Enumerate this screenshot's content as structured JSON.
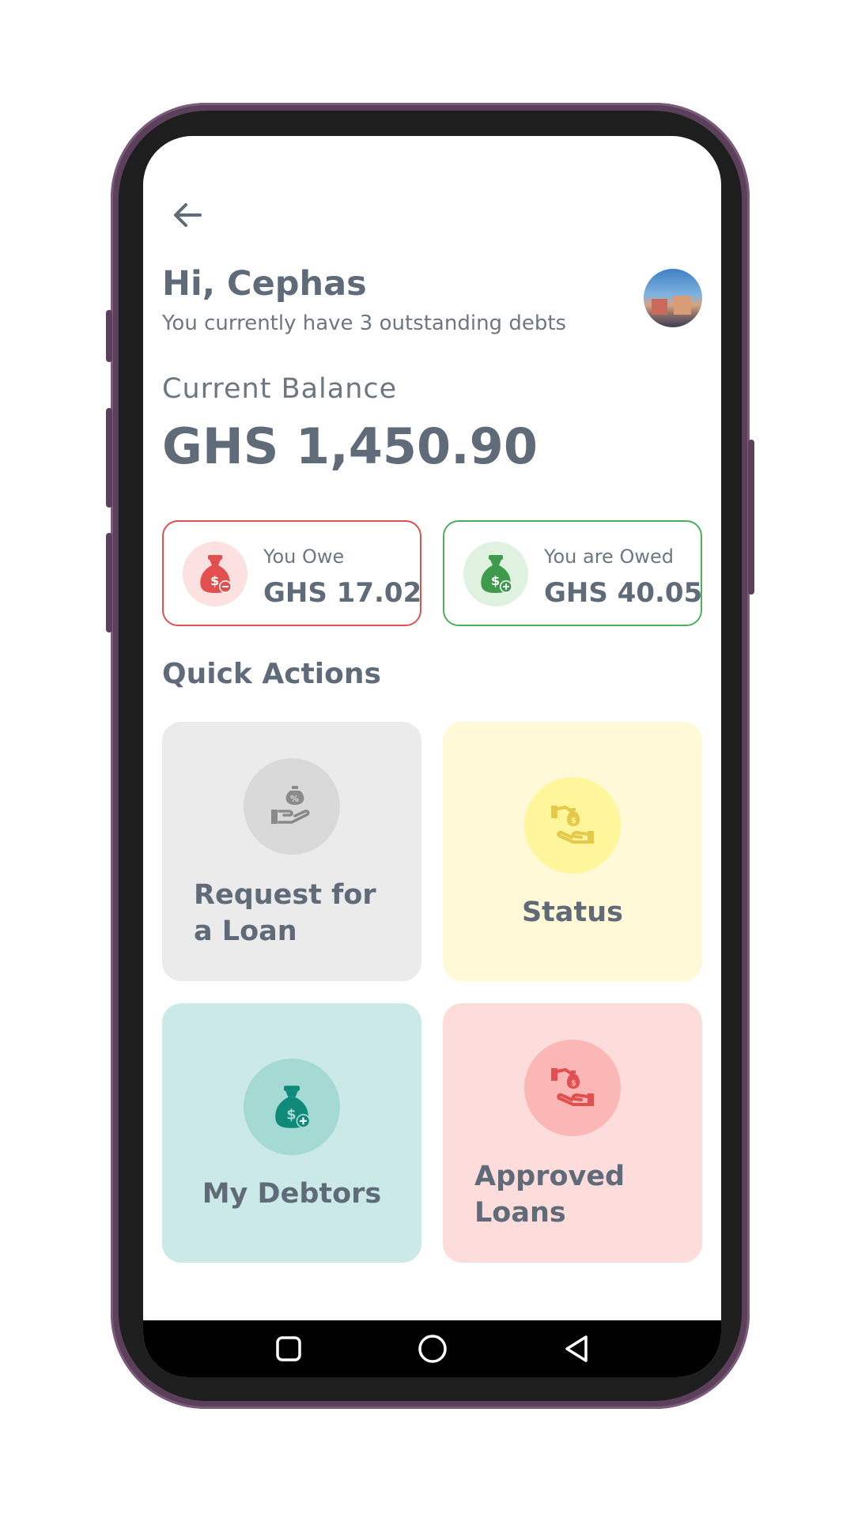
{
  "header": {
    "greeting": "Hi, Cephas",
    "subtitle": "You currently have 3 outstanding debts"
  },
  "balance": {
    "label": "Current Balance",
    "value": "GHS 1,450.90"
  },
  "summary": {
    "owe": {
      "label": "You Owe",
      "amount": "GHS 17.02",
      "accent": "#e24f4f"
    },
    "owed": {
      "label": "You are Owed",
      "amount": "GHS 40.05",
      "accent": "#4caf5a"
    }
  },
  "quick_actions": {
    "title": "Quick Actions",
    "items": [
      {
        "label": "Request for a Loan",
        "icon": "hand-percent-bag-icon",
        "color": "#ebebeb"
      },
      {
        "label": "Status",
        "icon": "hand-money-exchange-icon",
        "color": "#fff9d7"
      },
      {
        "label": "My Debtors",
        "icon": "money-bag-plus-icon",
        "color": "#cbe9e7"
      },
      {
        "label": "Approved Loans",
        "icon": "hand-money-exchange-icon",
        "color": "#fddcdc"
      }
    ]
  },
  "navbar": {
    "buttons": [
      "recents-icon",
      "home-icon",
      "back-triangle-icon"
    ]
  }
}
